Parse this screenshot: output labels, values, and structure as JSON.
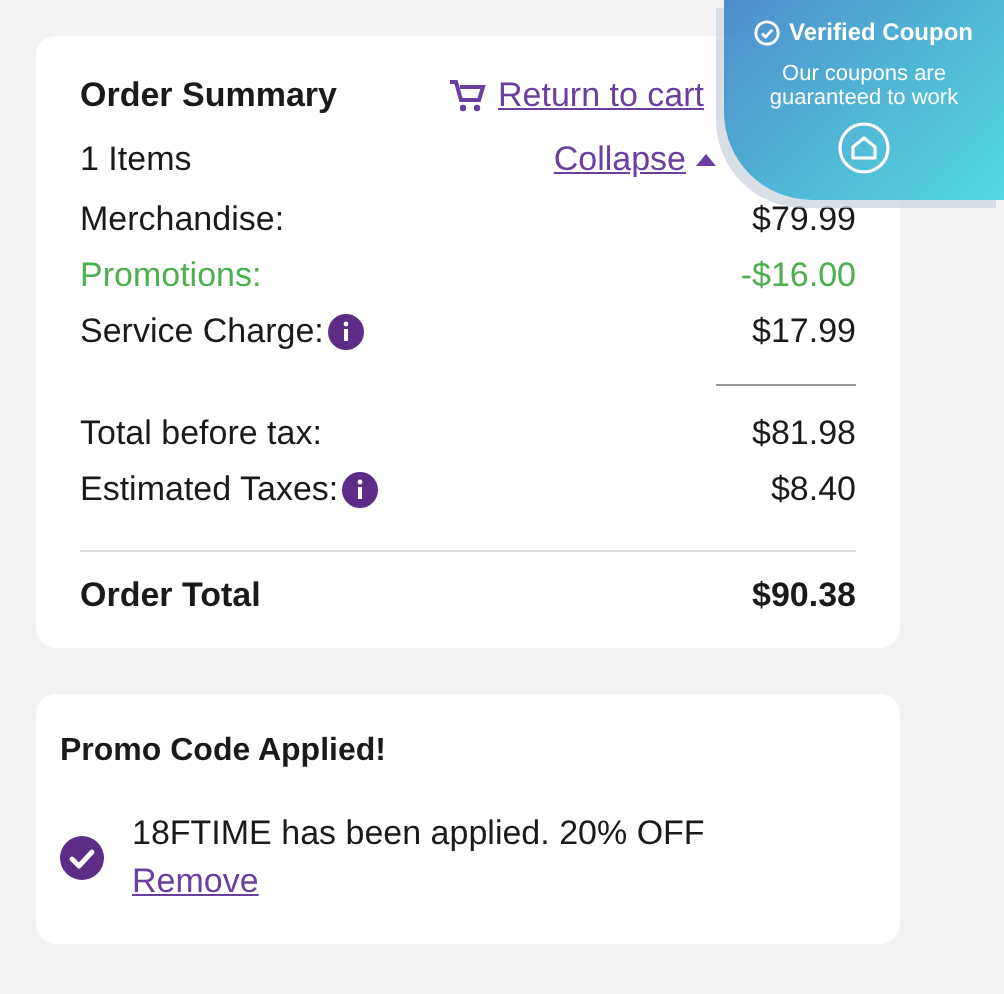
{
  "order_summary": {
    "title": "Order Summary",
    "return_link": "Return to cart",
    "items_count": "1 Items",
    "collapse_link": "Collapse",
    "expanded": true,
    "rows": [
      {
        "label": "Merchandise:",
        "value": "$79.99",
        "kind": "normal",
        "info": false,
        "divider_before": false
      },
      {
        "label": "Promotions:",
        "value": "-$16.00",
        "kind": "discount",
        "info": false,
        "divider_before": false
      },
      {
        "label": "Service Charge:",
        "value": "$17.99",
        "kind": "normal",
        "info": true,
        "divider_before": false
      },
      {
        "label": "Total before tax:",
        "value": "$81.98",
        "kind": "normal",
        "info": false,
        "divider_before": true
      },
      {
        "label": "Estimated Taxes:",
        "value": "$8.40",
        "kind": "normal",
        "info": true,
        "divider_before": false
      }
    ],
    "total": {
      "label": "Order Total",
      "value": "$90.38"
    }
  },
  "promo": {
    "title": "Promo Code Applied!",
    "message": "18FTIME has been applied. 20% OFF",
    "remove_link": "Remove"
  },
  "coupon_badge": {
    "title": "Verified Coupon",
    "message": "Our coupons are guaranteed to work"
  }
}
